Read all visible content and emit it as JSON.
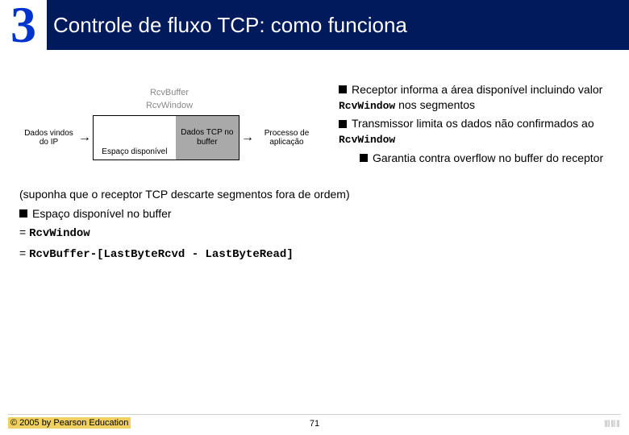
{
  "header": {
    "chapter_number": "3",
    "title": "Controle de fluxo TCP: como funciona"
  },
  "diagram": {
    "top_label1": "RcvBuffer",
    "top_label2": "RcvWindow",
    "left_arrow_label": "Dados vindos do IP",
    "empty_label": "Espaço disponível",
    "data_label": "Dados TCP no buffer",
    "right_arrow_label": "Processo de aplicação"
  },
  "bullets": {
    "b1_pre": "Receptor informa a área disponível incluindo valor ",
    "b1_code": "RcvWindow",
    "b1_post": " nos segmentos",
    "b2_pre": "Transmissor limita os dados não confirmados ao ",
    "b2_code": "RcvWindow",
    "b3": "Garantia contra overflow no buffer do receptor"
  },
  "lower": {
    "note": "(suponha que o receptor TCP descarte segmentos fora de ordem)",
    "line_bullet": "Espaço disponível no buffer",
    "eq1_lead": "= ",
    "eq1": "RcvWindow",
    "eq2_lead": "= ",
    "eq2": "RcvBuffer-[LastByteRcvd - LastByteRead]"
  },
  "footer": {
    "copyright": "© 2005 by Pearson Education",
    "page": "71",
    "barcode": "||||| |||| |||"
  }
}
